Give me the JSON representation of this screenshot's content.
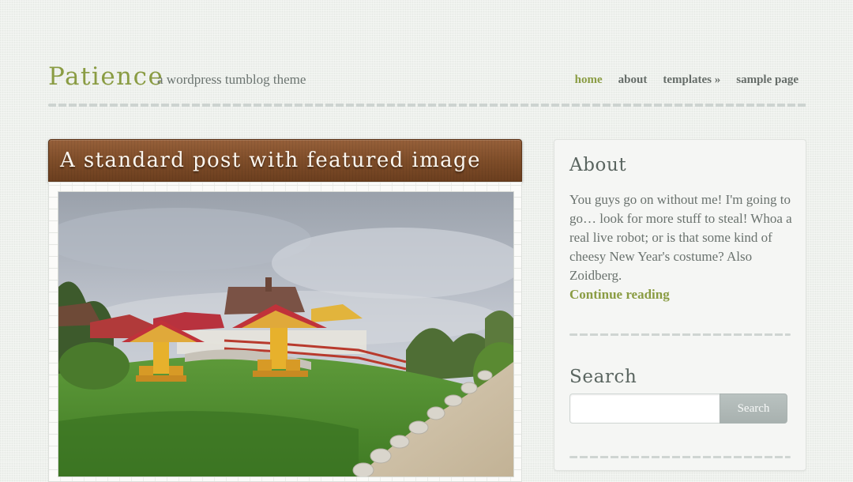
{
  "header": {
    "site_title": "Patience",
    "tagline": "a wordpress tumblog theme",
    "nav": [
      {
        "label": "home",
        "active": true
      },
      {
        "label": "about",
        "active": false
      },
      {
        "label": "templates »",
        "active": false
      },
      {
        "label": "sample page",
        "active": false
      }
    ]
  },
  "post": {
    "title": "A standard post with featured image"
  },
  "sidebar": {
    "about": {
      "title": "About",
      "text": "You guys go on without me! I'm going to go… look for more stuff to steal! Whoa a real live robot; or is that some kind of cheesy New Year's costume? Also Zoidberg.",
      "link_label": "Continue reading"
    },
    "search": {
      "title": "Search",
      "input_value": "",
      "button_label": "Search"
    }
  },
  "colors": {
    "accent_green": "#8a9c43",
    "title_bar_brown": "#7d4c28",
    "page_background": "#eef1ed",
    "search_button": "#aab3b1"
  }
}
